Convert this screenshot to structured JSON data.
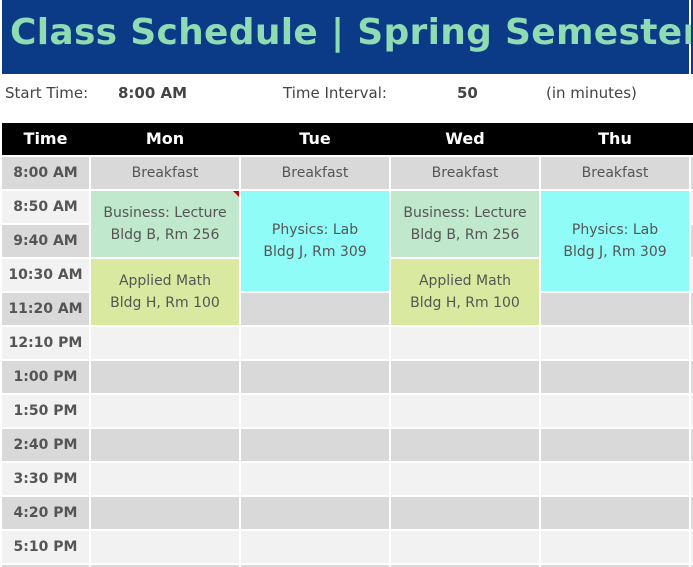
{
  "header": {
    "title": "Class Schedule | Spring Semester"
  },
  "settings": {
    "start_time_label": "Start Time:",
    "start_time_value": "8:00 AM",
    "interval_label": "Time Interval:",
    "interval_value": "50",
    "interval_unit": "(in minutes)"
  },
  "table": {
    "columns": [
      "Time",
      "Mon",
      "Tue",
      "Wed",
      "Thu"
    ],
    "times": [
      "8:00 AM",
      "8:50 AM",
      "9:40 AM",
      "10:30 AM",
      "11:20 AM",
      "12:10 PM",
      "1:00 PM",
      "1:50 PM",
      "2:40 PM",
      "3:30 PM",
      "4:20 PM",
      "5:10 PM"
    ],
    "events": {
      "breakfast": "Breakfast",
      "business": {
        "title": "Business: Lecture",
        "location": "Bldg B, Rm 256"
      },
      "physics": {
        "title": "Physics: Lab",
        "location": "Bldg J, Rm 309"
      },
      "math": {
        "title": "Applied Math",
        "location": "Bldg H, Rm 100"
      }
    }
  },
  "colors": {
    "title_bg": "#0b3a86",
    "title_text": "#8fdcb4",
    "business": "#bfe8cc",
    "physics": "#8ffcf8",
    "math": "#d9eaa0",
    "comment_flag": "#c00000"
  }
}
